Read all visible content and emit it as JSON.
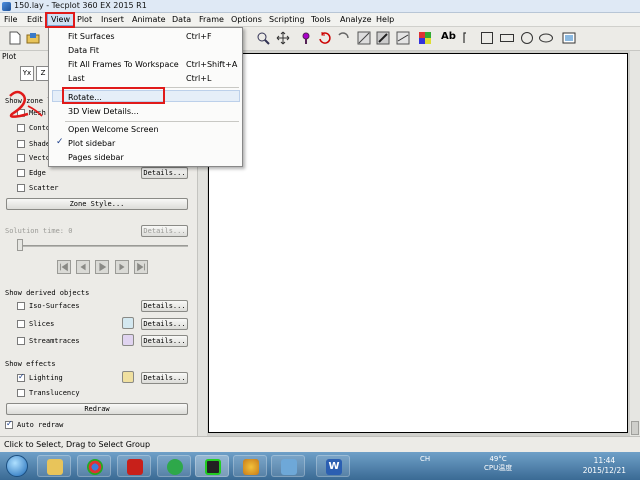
{
  "window": {
    "title": "150.lay - Tecplot 360 EX 2015 R1"
  },
  "menu": {
    "items": [
      "File",
      "Edit",
      "View",
      "Plot",
      "Insert",
      "Animate",
      "Data",
      "Frame",
      "Options",
      "Scripting",
      "Tools",
      "Analyze",
      "Help"
    ],
    "active": "View"
  },
  "view_menu": {
    "items": [
      {
        "label": "Fit Surfaces",
        "shortcut": "Ctrl+F"
      },
      {
        "label": "Data Fit",
        "shortcut": ""
      },
      {
        "label": "Fit All Frames To Workspace",
        "shortcut": "Ctrl+Shift+A"
      },
      {
        "label": "Last",
        "shortcut": "Ctrl+L"
      },
      {
        "label": "Rotate...",
        "shortcut": ""
      },
      {
        "label": "3D View Details...",
        "shortcut": ""
      },
      {
        "label": "Open Welcome Screen",
        "shortcut": ""
      },
      {
        "label": "Plot sidebar",
        "shortcut": "",
        "checked": true
      },
      {
        "label": "Pages sidebar",
        "shortcut": ""
      }
    ],
    "highlighted": "Rotate..."
  },
  "sidebar": {
    "title": "Plot",
    "view_buttons": [
      "Y\nx",
      "Z"
    ],
    "zone_layers": {
      "heading": "Show zone l",
      "items": [
        {
          "label": "Mesh",
          "checked": false
        },
        {
          "label": "Conto",
          "checked": false
        },
        {
          "label": "Shade",
          "checked": false
        },
        {
          "label": "Vecto",
          "checked": false
        },
        {
          "label": "Edge",
          "checked": false,
          "button": "Details..."
        },
        {
          "label": "Scatter",
          "checked": false
        }
      ],
      "zone_style_button": "Zone Style..."
    },
    "solution_time": {
      "label": "Solution time: 0",
      "button": "Details..."
    },
    "derived": {
      "heading": "Show derived objects",
      "items": [
        {
          "label": "Iso-Surfaces",
          "checked": false,
          "button": "Details..."
        },
        {
          "label": "Slices",
          "checked": false,
          "button": "Details..."
        },
        {
          "label": "Streamtraces",
          "checked": false,
          "button": "Details..."
        }
      ]
    },
    "effects": {
      "heading": "Show effects",
      "items": [
        {
          "label": "Lighting",
          "checked": true,
          "button": "Details..."
        },
        {
          "label": "Translucency",
          "checked": false
        }
      ]
    },
    "redraw_button": "Redraw",
    "auto_redraw": {
      "label": "Auto redraw",
      "checked": true
    }
  },
  "status": {
    "text": "Click to Select, Drag to Select Group"
  },
  "taskbar": {
    "tray_lang": "CH",
    "temperature": "49°C",
    "cpu_label": "CPU温度",
    "time": "11:44",
    "date": "2015/12/21"
  },
  "colors": {
    "annotation": "#e01a1a",
    "accent": "#1a3d8a"
  }
}
